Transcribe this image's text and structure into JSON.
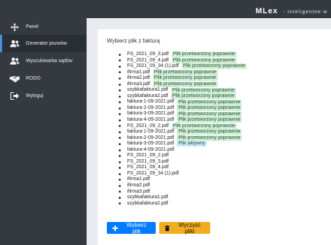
{
  "header": {
    "brand": "MLex",
    "tagline": "- Inteligentne w"
  },
  "sidebar": {
    "items": [
      {
        "label": "Panel",
        "icon": "arrows-icon"
      },
      {
        "label": "Generator pozwów",
        "icon": "users-icon",
        "active": true
      },
      {
        "label": "Wyszukiwarka sądów",
        "icon": "users-icon"
      },
      {
        "label": "RODO",
        "icon": "handshake-icon"
      },
      {
        "label": "Wyloguj",
        "icon": "sign-out-icon"
      }
    ]
  },
  "main": {
    "title": "Wybierz plik z fakturą",
    "files": [
      {
        "name": "FS_2021_09_3.pdf",
        "status": "Plik przetworzony poprawnie",
        "status_type": "processed"
      },
      {
        "name": "FS_2021_09_4.pdf",
        "status": "Plik przetworzony poprawnie",
        "status_type": "processed"
      },
      {
        "name": "FS_2021_09_34 (1).pdf",
        "status": "Plik przetworzony poprawnie",
        "status_type": "processed"
      },
      {
        "name": "ifirma1.pdf",
        "status": "Plik przetworzony poprawnie",
        "status_type": "processed"
      },
      {
        "name": "ifirma2.pdf",
        "status": "Plik przetworzony poprawnie",
        "status_type": "processed"
      },
      {
        "name": "ifirma3.pdf",
        "status": "Plik przetworzony poprawnie",
        "status_type": "processed"
      },
      {
        "name": "szybkafaktura1.pdf",
        "status": "Plik przetworzony poprawnie",
        "status_type": "processed"
      },
      {
        "name": "szybkafaktura2.pdf",
        "status": "Plik przetworzony poprawnie",
        "status_type": "processed"
      },
      {
        "name": "faktura-1-09-2021.pdf",
        "status": "Plik przetworzony poprawnie",
        "status_type": "processed"
      },
      {
        "name": "faktura-2-09-2021.pdf",
        "status": "Plik przetworzony poprawnie",
        "status_type": "processed"
      },
      {
        "name": "faktura-3-09-2021.pdf",
        "status": "Plik przetworzony poprawnie",
        "status_type": "processed"
      },
      {
        "name": "faktura-4-09-2021.pdf",
        "status": "Plik przetworzony poprawnie",
        "status_type": "processed"
      },
      {
        "name": "FS_2021_09_2.pdf",
        "status": "Plik przetworzony poprawnie",
        "status_type": "processed"
      },
      {
        "name": "faktura-1-09-2021.pdf",
        "status": "Plik przetworzony poprawnie",
        "status_type": "processed"
      },
      {
        "name": "faktura-2-09-2021.pdf",
        "status": "Plik przetworzony poprawnie",
        "status_type": "processed"
      },
      {
        "name": "faktura-3-09-2021.pdf",
        "status": "Plik aktywny",
        "status_type": "active"
      },
      {
        "name": "faktura-4-09-2021.pdf",
        "status": "",
        "status_type": ""
      },
      {
        "name": "FS_2021_09_2.pdf",
        "status": "",
        "status_type": ""
      },
      {
        "name": "FS_2021_09_3.pdf",
        "status": "",
        "status_type": ""
      },
      {
        "name": "FS_2021_09_4.pdf",
        "status": "",
        "status_type": ""
      },
      {
        "name": "FS_2021_09_34 (1).pdf",
        "status": "",
        "status_type": ""
      },
      {
        "name": "ifirma1.pdf",
        "status": "",
        "status_type": ""
      },
      {
        "name": "ifirma2.pdf",
        "status": "",
        "status_type": ""
      },
      {
        "name": "ifirma3.pdf",
        "status": "",
        "status_type": ""
      },
      {
        "name": "szybkafaktura1.pdf",
        "status": "",
        "status_type": ""
      },
      {
        "name": "szybkafaktura2.pdf",
        "status": "",
        "status_type": ""
      }
    ],
    "buttons": {
      "select": {
        "label": "Wybierz plik",
        "icon": "plus-icon"
      },
      "clear": {
        "label": "Wyczyść pliki",
        "icon": "trash-icon"
      }
    }
  },
  "colors": {
    "sidebar_bg": "#343a40",
    "processed_badge_bg": "#d4edda",
    "active_badge_bg": "#d1ecf1",
    "primary": "#007bff",
    "warning": "#f0ad1e"
  }
}
